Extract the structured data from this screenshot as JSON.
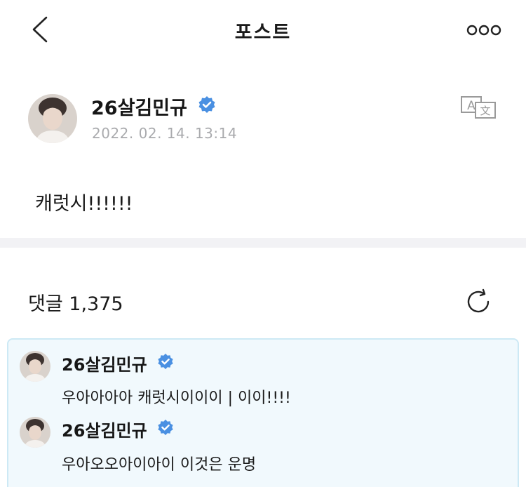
{
  "header": {
    "title": "포스트",
    "back_icon": "chevron-left-icon",
    "more_icon": "more-horizontal-icon"
  },
  "post": {
    "author": "26살김민규",
    "timestamp": "2022. 02. 14. 13:14",
    "body": "캐럿시!!!!!!",
    "verified_icon": "verified-badge-icon",
    "translate_icon": "translate-icon"
  },
  "comments": {
    "label": "댓글 1,375",
    "refresh_icon": "refresh-icon",
    "items": [
      {
        "author": "26살김민규",
        "text": "우아아아아 캐럿시이이이 | 이이!!!!"
      },
      {
        "author": "26살김민규",
        "text": "우아오오아이아이 이것은 운명"
      }
    ]
  },
  "colors": {
    "verified": "#4a90e2",
    "timestamp": "#a9aaad",
    "highlight_bg": "#f1f9fd",
    "highlight_border": "#cde9f5",
    "divider": "#f2f2f5"
  }
}
